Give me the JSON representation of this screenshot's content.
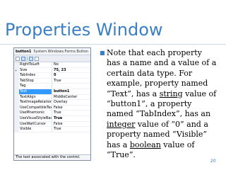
{
  "slide": {
    "title": "Properties Window",
    "page_number": "20"
  },
  "properties_panel": {
    "object_name": "button1",
    "object_type": "System.Windows.Forms.Button",
    "rows": [
      {
        "name": "RightToLeft",
        "value": "No",
        "bold": false,
        "expand": ""
      },
      {
        "name": "Size",
        "value": "75, 23",
        "bold": true,
        "expand": "+"
      },
      {
        "name": "TabIndex",
        "value": "0",
        "bold": true,
        "expand": ""
      },
      {
        "name": "TabStop",
        "value": "True",
        "bold": false,
        "expand": ""
      },
      {
        "name": "Tag",
        "value": "",
        "bold": false,
        "expand": ""
      },
      {
        "name": "Text",
        "value": "button1",
        "bold": true,
        "expand": "",
        "selected": true
      },
      {
        "name": "TextAlign",
        "value": "MiddleCenter",
        "bold": false,
        "expand": ""
      },
      {
        "name": "TextImageRelation",
        "value": "Overlay",
        "bold": false,
        "expand": ""
      },
      {
        "name": "UseCompatibleTextRendering",
        "value": "False",
        "bold": false,
        "expand": ""
      },
      {
        "name": "UseMnemonic",
        "value": "True",
        "bold": false,
        "expand": ""
      },
      {
        "name": "UseVisualStyleBackColor",
        "value": "True",
        "bold": true,
        "expand": ""
      },
      {
        "name": "UseWaitCursor",
        "value": "False",
        "bold": false,
        "expand": ""
      },
      {
        "name": "Visible",
        "value": "True",
        "bold": false,
        "expand": ""
      }
    ],
    "description": "The text associated with the control."
  },
  "bullet": {
    "p1": "Note that each property has a name and a value of a certain data type. For example, property named “Text”, has a ",
    "u1": "string",
    "p2": " value of “button1”, a property named “TabIndex”, has an ",
    "u2": "integer",
    "p3": " value of “0” and a property named “Visible” has a ",
    "u3": "boolean",
    "p4": " value of “True”."
  },
  "colors": {
    "title": "#3a7fc4",
    "selection": "#3399ff"
  },
  "icons": [
    "bullet-icon",
    "categorized-icon",
    "alphabetical-icon",
    "properties-icon",
    "events-icon",
    "expand-icon"
  ]
}
